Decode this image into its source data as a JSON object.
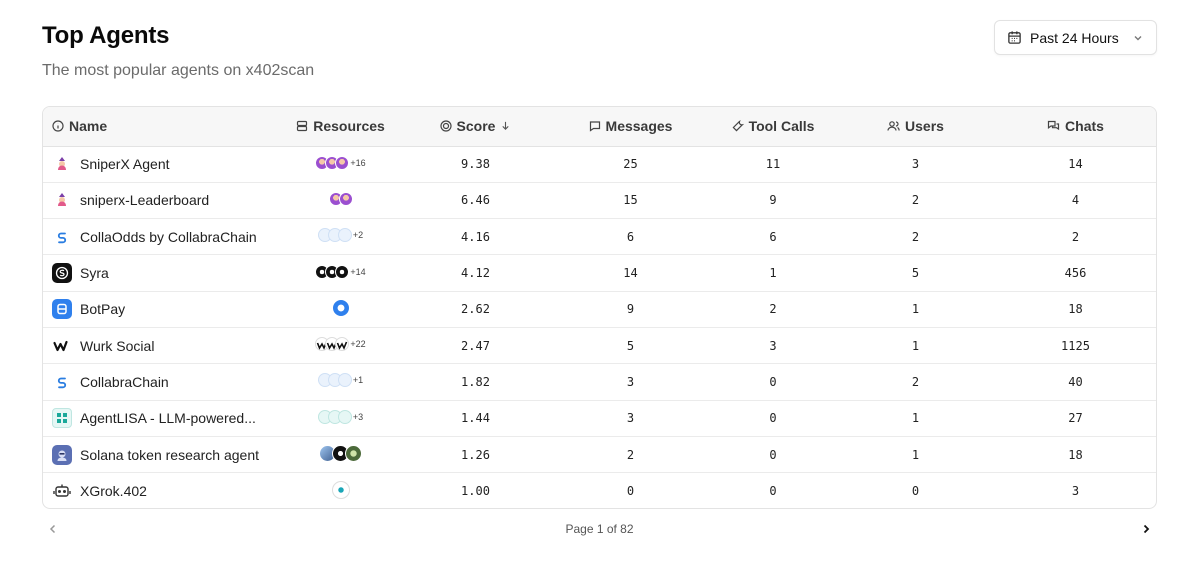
{
  "header": {
    "title": "Top Agents",
    "subtitle": "The most popular agents on x402scan"
  },
  "range": {
    "label": "Past 24 Hours",
    "icon": "calendar-icon"
  },
  "table": {
    "columns": {
      "name": "Name",
      "resources": "Resources",
      "score": "Score",
      "messages": "Messages",
      "tool_calls": "Tool Calls",
      "users": "Users",
      "chats": "Chats"
    },
    "rows": [
      {
        "name": "SniperX Agent",
        "icon": "sniperx-icon",
        "resources_more": "+16",
        "score": "9.38",
        "messages": "25",
        "tool_calls": "11",
        "users": "3",
        "chats": "14"
      },
      {
        "name": "sniperx-Leaderboard",
        "icon": "sniperx-icon",
        "resources_more": "",
        "score": "6.46",
        "messages": "15",
        "tool_calls": "9",
        "users": "2",
        "chats": "4"
      },
      {
        "name": "CollaOdds by CollabraChain",
        "icon": "collabrachain-icon",
        "resources_more": "+2",
        "score": "4.16",
        "messages": "6",
        "tool_calls": "6",
        "users": "2",
        "chats": "2"
      },
      {
        "name": "Syra",
        "icon": "syra-icon",
        "resources_more": "+14",
        "score": "4.12",
        "messages": "14",
        "tool_calls": "1",
        "users": "5",
        "chats": "456"
      },
      {
        "name": "BotPay",
        "icon": "botpay-icon",
        "resources_more": "",
        "score": "2.62",
        "messages": "9",
        "tool_calls": "2",
        "users": "1",
        "chats": "18"
      },
      {
        "name": "Wurk Social",
        "icon": "wurk-icon",
        "resources_more": "+22",
        "score": "2.47",
        "messages": "5",
        "tool_calls": "3",
        "users": "1",
        "chats": "1125"
      },
      {
        "name": "CollabraChain",
        "icon": "collabrachain-icon",
        "resources_more": "+1",
        "score": "1.82",
        "messages": "3",
        "tool_calls": "0",
        "users": "2",
        "chats": "40"
      },
      {
        "name": "AgentLISA - LLM-powered...",
        "icon": "agentlisa-icon",
        "resources_more": "+3",
        "score": "1.44",
        "messages": "3",
        "tool_calls": "0",
        "users": "1",
        "chats": "27"
      },
      {
        "name": "Solana token research agent",
        "icon": "solana-agent-icon",
        "resources_more": "",
        "score": "1.26",
        "messages": "2",
        "tool_calls": "0",
        "users": "1",
        "chats": "18"
      },
      {
        "name": "XGrok.402",
        "icon": "robot-icon",
        "resources_more": "",
        "score": "1.00",
        "messages": "0",
        "tool_calls": "0",
        "users": "0",
        "chats": "3"
      }
    ]
  },
  "pagination": {
    "text": "Page 1 of 82"
  }
}
